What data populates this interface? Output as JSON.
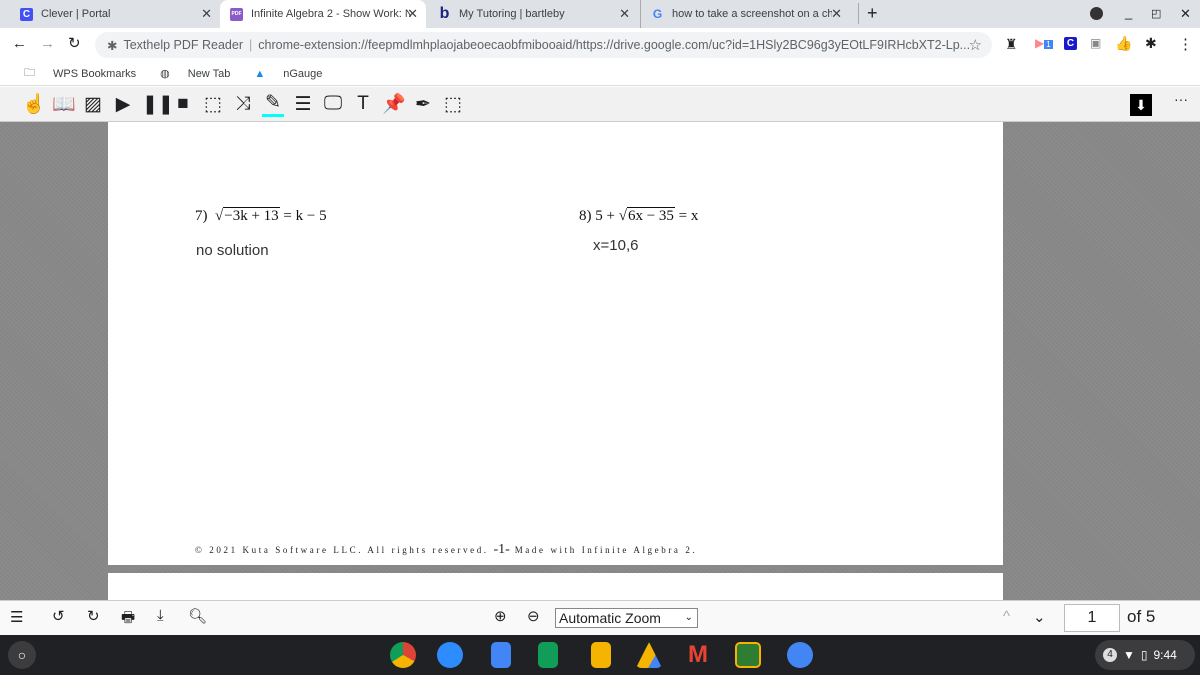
{
  "tabs": [
    {
      "title": "Clever | Portal",
      "icon": "clever-icon"
    },
    {
      "title": "Infinite Algebra 2 - Show Work: N",
      "icon": "pdf-icon",
      "active": true
    },
    {
      "title": "My Tutoring | bartleby",
      "icon": "bartleby-icon"
    },
    {
      "title": "how to take a screenshot on a ch",
      "icon": "google-icon"
    }
  ],
  "address": {
    "extension": "Texthelp PDF Reader",
    "url": "chrome-extension://feepmdlmhplaojabeoecaobfmibooaid/https://drive.google.com/uc?id=1HSly2BC96g3yEOtLF9IRHcbXT2-Lp..."
  },
  "extensions_badge": "1",
  "bookmarks": [
    "WPS Bookmarks",
    "New Tab",
    "nGauge"
  ],
  "pdf": {
    "problem7": {
      "num": "7)",
      "radicand": "−3k + 13",
      "rhs": "= k − 5",
      "answer": "no solution"
    },
    "problem8": {
      "num": "8)",
      "lhs": "5 +",
      "radicand": "6x − 35",
      "rhs": "= x",
      "answer": "x=10,6"
    },
    "footer": "© 2021 Kuta Software LLC.  All rights reserved.",
    "page_marker": "-1-",
    "footer2": "Made with Infinite Algebra 2."
  },
  "pdfbar": {
    "zoom": "Automatic Zoom",
    "page": "1",
    "of": "of 5"
  },
  "shelf": {
    "notifications": "4",
    "time": "9:44"
  },
  "colors": {
    "chrome_tabbar": "#dee1e6",
    "shelf": "#202124",
    "clever": "#4250f5"
  }
}
